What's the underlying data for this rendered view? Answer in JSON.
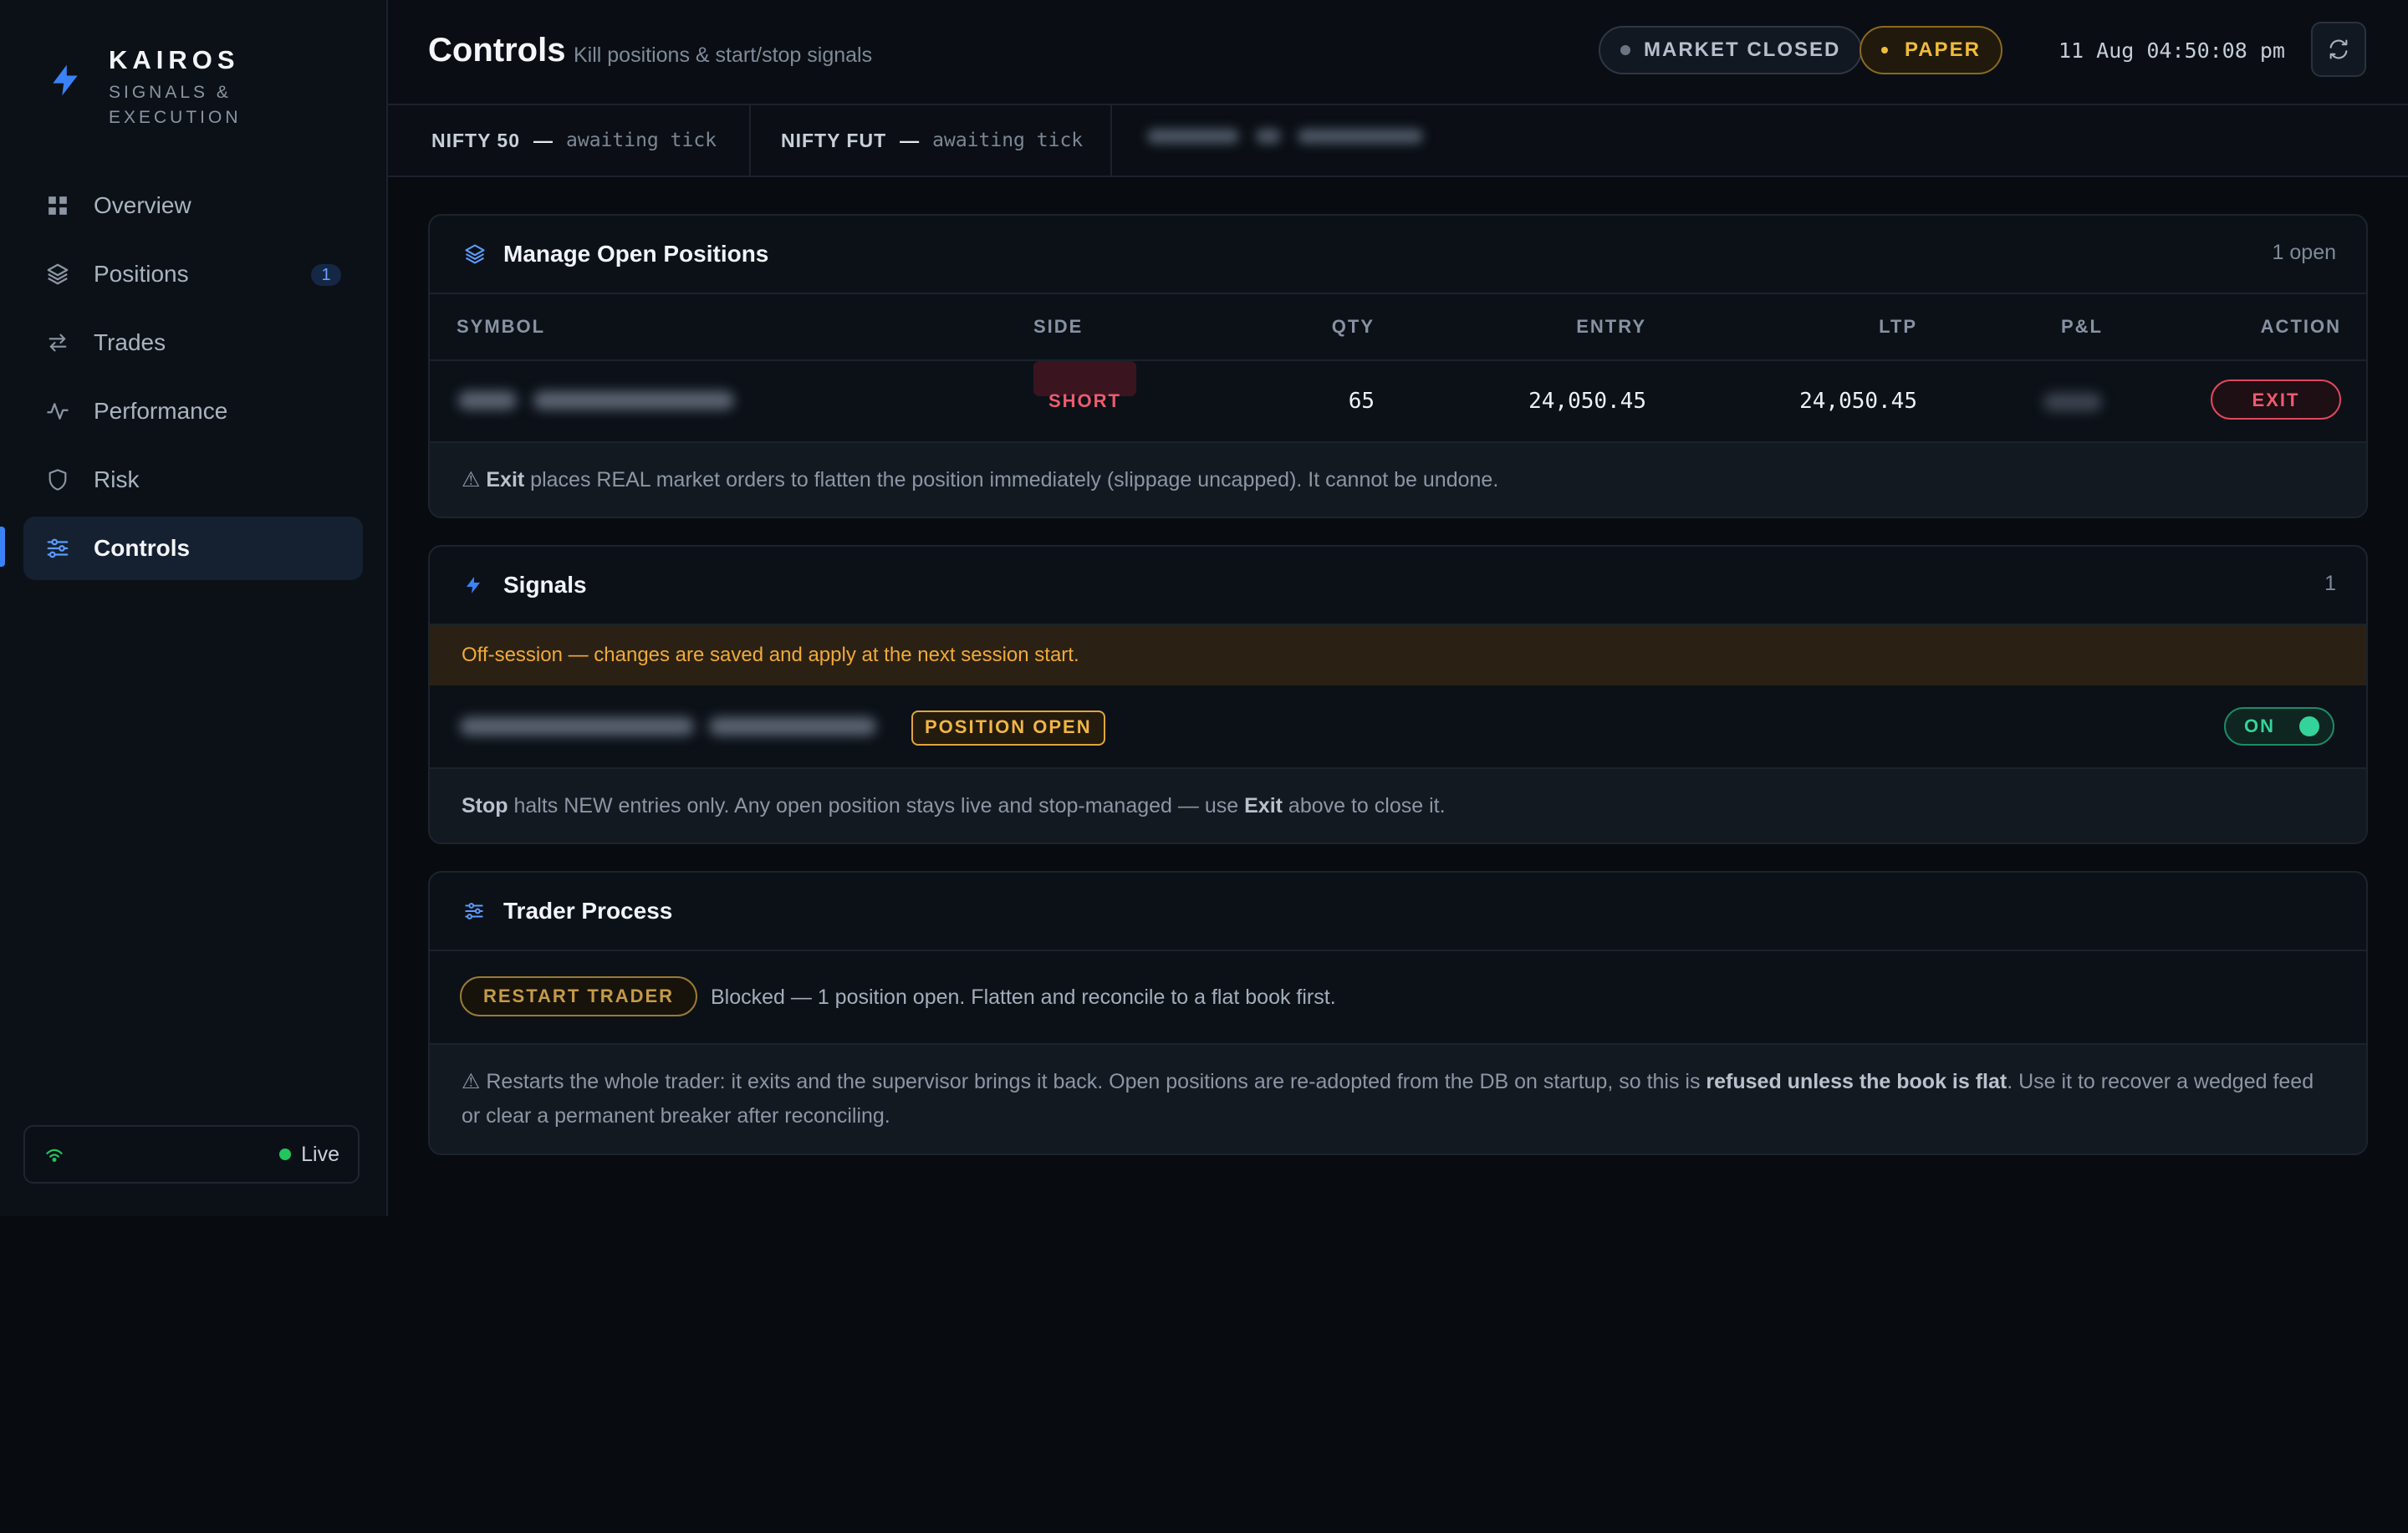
{
  "brand": {
    "name": "KAIROS",
    "subtitle": "SIGNALS & EXECUTION"
  },
  "nav": [
    {
      "label": "Overview",
      "icon": "grid-icon"
    },
    {
      "label": "Positions",
      "icon": "layers-icon",
      "badge": "1"
    },
    {
      "label": "Trades",
      "icon": "swap-icon"
    },
    {
      "label": "Performance",
      "icon": "activity-icon"
    },
    {
      "label": "Risk",
      "icon": "shield-icon"
    },
    {
      "label": "Controls",
      "icon": "sliders-icon",
      "active": true
    }
  ],
  "connection": {
    "status": "Live"
  },
  "header": {
    "title": "Controls",
    "subtitle": "Kill positions & start/stop signals",
    "market_status": "MARKET CLOSED",
    "mode": "PAPER",
    "clock": "11 Aug 04:50:08 pm"
  },
  "ticker": [
    {
      "name": "NIFTY 50",
      "dash": "—",
      "state": "awaiting tick"
    },
    {
      "name": "NIFTY FUT",
      "dash": "—",
      "state": "awaiting tick"
    }
  ],
  "positions": {
    "title": "Manage Open Positions",
    "count": "1 open",
    "columns": [
      "SYMBOL",
      "SIDE",
      "QTY",
      "ENTRY",
      "LTP",
      "P&L",
      "ACTION"
    ],
    "rows": [
      {
        "side": "SHORT",
        "qty": "65",
        "entry": "24,050.45",
        "ltp": "24,050.45",
        "action": "EXIT"
      }
    ],
    "note_icon": "⚠",
    "note_bold": "Exit",
    "note_text": " places REAL market orders to flatten the position immediately (slippage uncapped). It cannot be undone."
  },
  "signals": {
    "title": "Signals",
    "count": "1",
    "warning": "Off-session — changes are saved and apply at the next session start.",
    "items": [
      {
        "status": "POSITION OPEN",
        "toggle": "ON"
      }
    ],
    "note_bold1": "Stop",
    "note_text1": " halts NEW entries only. Any open position stays live and stop-managed — use ",
    "note_bold2": "Exit",
    "note_text2": " above to close it."
  },
  "trader": {
    "title": "Trader Process",
    "button": "RESTART TRADER",
    "message": "Blocked — 1 position open. Flatten and reconcile to a flat book first.",
    "note_icon": "⚠",
    "note_text1": " Restarts the whole trader: it exits and the supervisor brings it back. Open positions are re-adopted from the DB on startup, so this is ",
    "note_bold": "refused unless the book is flat",
    "note_text2": ". Use it to recover a wedged feed or clear a permanent breaker after reconciling."
  },
  "colors": {
    "accent": "#3b82f6",
    "danger": "#f05a6e",
    "warning": "#f0b545",
    "success": "#34d399",
    "background": "#080b10"
  }
}
